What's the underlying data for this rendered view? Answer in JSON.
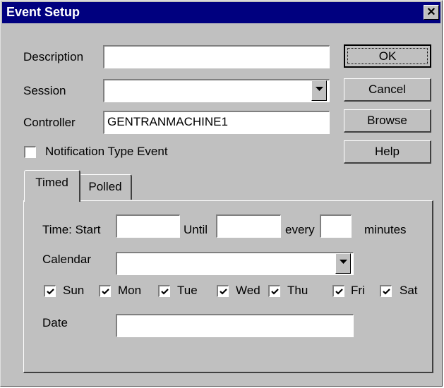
{
  "window": {
    "title": "Event Setup",
    "close_glyph": "✕"
  },
  "form": {
    "description_label": "Description",
    "description_value": "",
    "session_label": "Session",
    "session_value": "",
    "controller_label": "Controller",
    "controller_value": "GENTRANMACHINE1",
    "notification_label": "Notification Type Event",
    "notification_checked": false
  },
  "buttons": {
    "ok": "OK",
    "cancel": "Cancel",
    "browse": "Browse",
    "help": "Help"
  },
  "tabs": [
    {
      "label": "Timed",
      "active": true
    },
    {
      "label": "Polled",
      "active": false
    }
  ],
  "timed": {
    "time_start_label": "Time: Start",
    "start_value": "",
    "until_label": "Until",
    "until_value": "",
    "every_label": "every",
    "every_value": "",
    "minutes_label": "minutes",
    "calendar_label": "Calendar",
    "calendar_value": "",
    "days": [
      {
        "label": "Sun",
        "checked": true
      },
      {
        "label": "Mon",
        "checked": true
      },
      {
        "label": "Tue",
        "checked": true
      },
      {
        "label": "Wed",
        "checked": true
      },
      {
        "label": "Thu",
        "checked": true
      },
      {
        "label": "Fri",
        "checked": true
      },
      {
        "label": "Sat",
        "checked": true
      }
    ],
    "date_label": "Date",
    "date_value": ""
  }
}
